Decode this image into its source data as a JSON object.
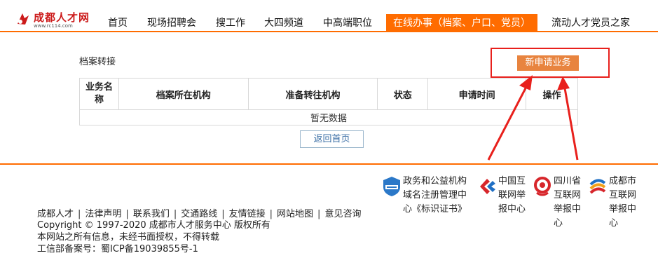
{
  "header": {
    "logo_name": "成都人才网",
    "logo_url": "www.rc114.com",
    "nav": [
      {
        "label": "首页"
      },
      {
        "label": "现场招聘会"
      },
      {
        "label": "搜工作"
      },
      {
        "label": "大四频道"
      },
      {
        "label": "中高端职位"
      },
      {
        "label": "在线办事（档案、户口、党员）"
      },
      {
        "label": "流动人才党员之家"
      }
    ],
    "active_color": "#ff6c00"
  },
  "main": {
    "title": "档案转接",
    "new_button_label": "新申请业务",
    "table": {
      "headers": [
        "业务名称",
        "档案所在机构",
        "准备转往机构",
        "状态",
        "申请时间",
        "操作"
      ],
      "header_c1_line1": "业务名",
      "header_c1_line2": "称",
      "empty_text": "暂无数据"
    },
    "back_button_label": "返回首页"
  },
  "footer": {
    "badges": [
      {
        "text": "政务和公益机构域名注册管理中心《标识证书》",
        "lines": [
          "政务和公益机构",
          "域名注册管理中",
          "心《标识证书》"
        ],
        "icon": "gov-badge-icon"
      },
      {
        "text": "中国互联网举报中心",
        "lines": [
          "中国互",
          "联网举",
          "报中心"
        ],
        "icon": "china-report-icon"
      },
      {
        "text": "四川省互联网举报中心",
        "lines": [
          "四川省",
          "互联网",
          "举报中",
          "心"
        ],
        "icon": "sichuan-report-icon"
      },
      {
        "text": "成都市互联网举报中心",
        "lines": [
          "成都市",
          "互联网",
          "举报中",
          "心"
        ],
        "icon": "chengdu-report-icon"
      }
    ],
    "links": [
      "成都人才",
      "法律声明",
      "联系我们",
      "交通路线",
      "友情链接",
      "网站地图",
      "意见咨询"
    ],
    "copyright": "Copyright © 1997-2020 成都市人才服务中心 版权所有",
    "notice": "本网站之所有信息，未经书面授权，不得转载",
    "icp": "工信部备案号：蜀ICP备19039855号-1"
  },
  "colors": {
    "accent": "#ff6c00",
    "button": "#e8843f",
    "annotation": "#e8201c",
    "back_button_text": "#3a6ea5"
  }
}
